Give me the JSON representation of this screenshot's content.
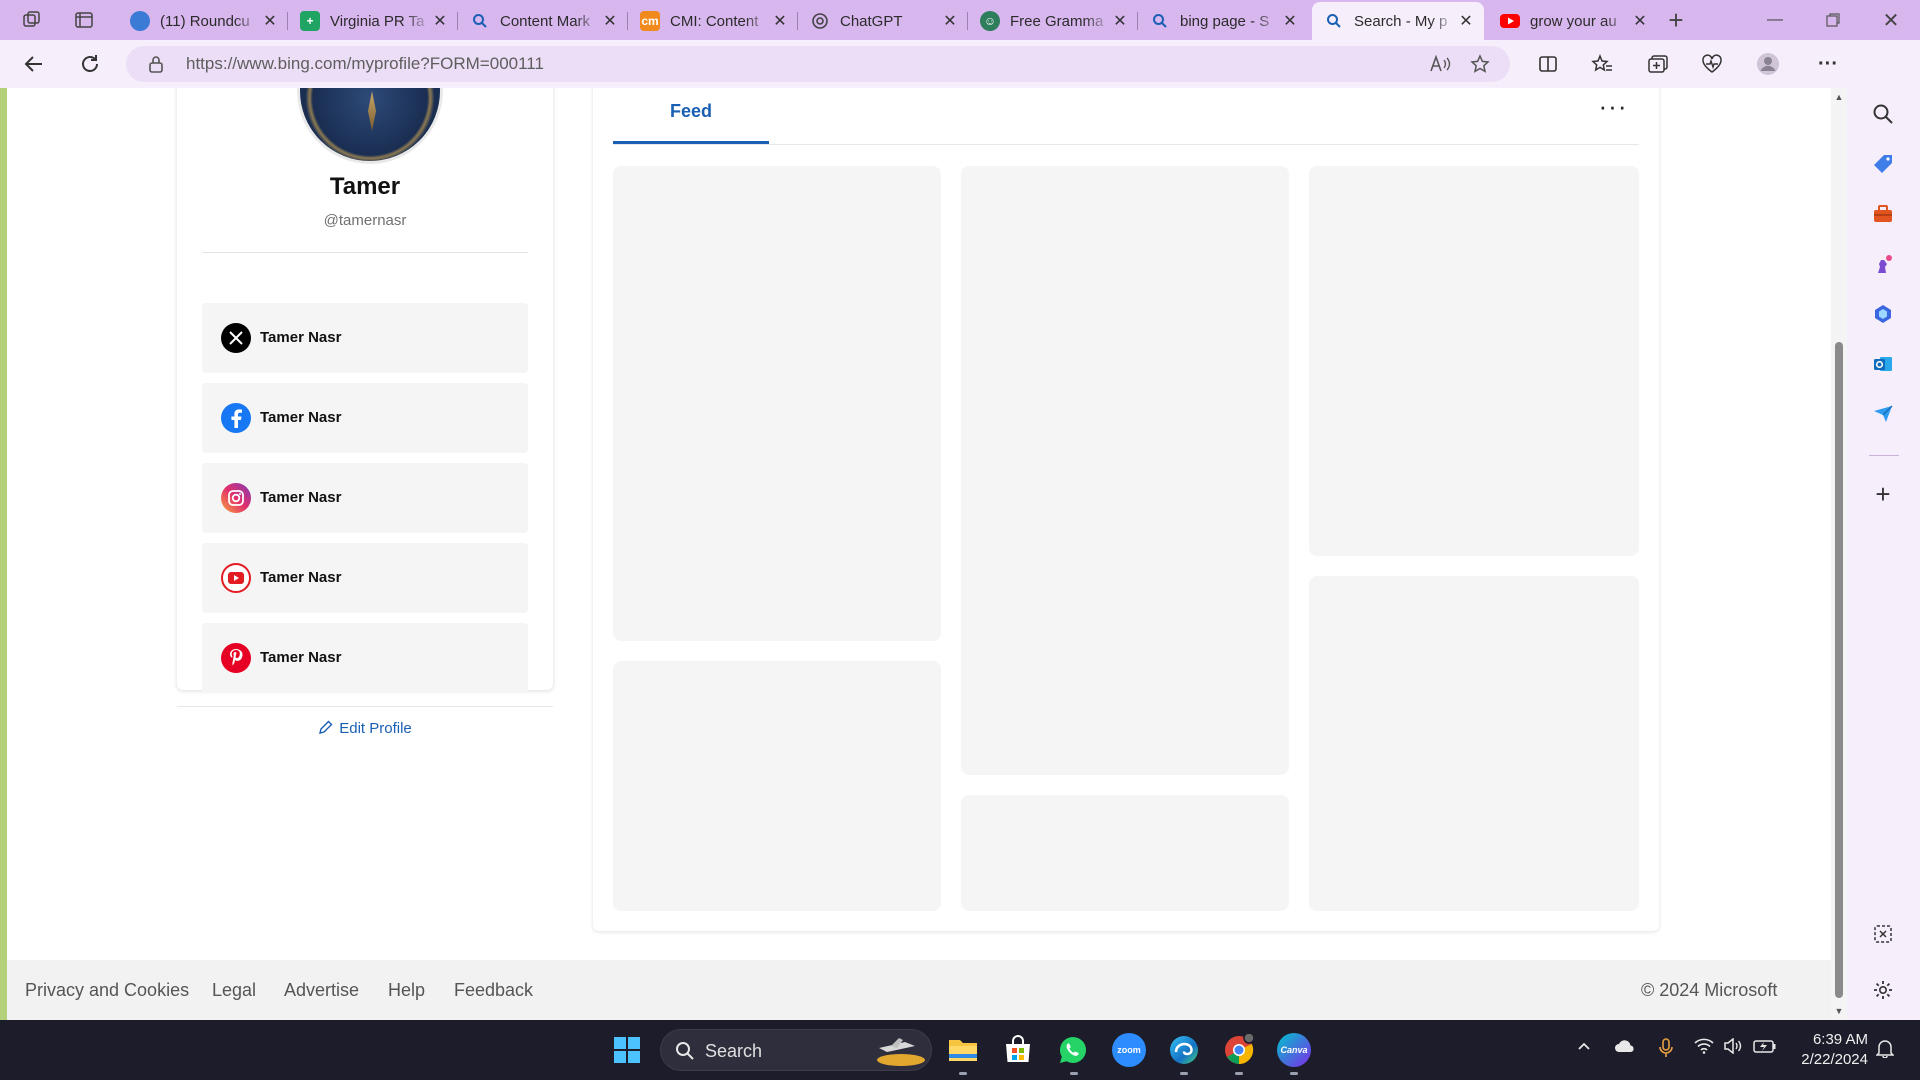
{
  "browser": {
    "tabs": [
      {
        "title": "(11) Roundcu",
        "favicon": "roundcube-icon",
        "color": "#3b7bd6"
      },
      {
        "title": "Virginia PR Ta",
        "favicon": "sheets-icon",
        "color": "#1fa463"
      },
      {
        "title": "Content Mark",
        "favicon": "search-icon",
        "color": "#1a5fb4"
      },
      {
        "title": "CMI: Content",
        "favicon": "cmi-icon",
        "color": "#f08a1c"
      },
      {
        "title": "ChatGPT",
        "favicon": "chatgpt-icon",
        "color": "#444444"
      },
      {
        "title": "Free Gramma",
        "favicon": "grammar-icon",
        "color": "#2e7d5b"
      },
      {
        "title": "bing page - S",
        "favicon": "search-icon",
        "color": "#1a5fb4"
      },
      {
        "title": "Search - My p",
        "favicon": "search-icon",
        "color": "#1a5fb4",
        "active": true
      },
      {
        "title": "grow your au",
        "favicon": "youtube-icon",
        "color": "#ff0000"
      }
    ],
    "url": "https://www.bing.com/myprofile?FORM=000111"
  },
  "profile": {
    "name": "Tamer",
    "handle": "@tamernasr",
    "socials": [
      {
        "network": "x",
        "label": "Tamer Nasr"
      },
      {
        "network": "facebook",
        "label": "Tamer Nasr"
      },
      {
        "network": "instagram",
        "label": "Tamer Nasr"
      },
      {
        "network": "youtube",
        "label": "Tamer Nasr"
      },
      {
        "network": "pinterest",
        "label": "Tamer Nasr"
      }
    ],
    "edit_label": "Edit Profile"
  },
  "feed": {
    "tab_label": "Feed",
    "more_label": "···"
  },
  "footer": {
    "links": [
      "Privacy and Cookies",
      "Legal",
      "Advertise",
      "Help",
      "Feedback"
    ],
    "copyright": "© 2024 Microsoft"
  },
  "taskbar": {
    "search_label": "Search",
    "time": "6:39 AM",
    "date": "2/22/2024"
  },
  "colors": {
    "accent": "#1a5fb4",
    "tabstrip": "#d8b7ee",
    "toolbar": "#f7eefc",
    "taskbar": "#1c1c2a"
  }
}
